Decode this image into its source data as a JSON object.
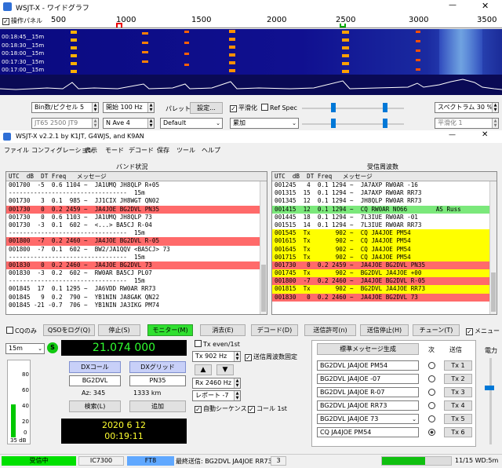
{
  "wide": {
    "title": "WSJT-X - ワイドグラフ",
    "controls_label": "操作パネル",
    "scale": [
      "500",
      "1000",
      "1500",
      "2000",
      "2500",
      "3000",
      "3500"
    ],
    "timestamps": [
      "00:18:45__15m",
      "00:18:30__15m",
      "00:18:00__15m",
      "00:17:30__15m",
      "00:17:00__15m"
    ],
    "bins_label": "Bin数/ピクセル 5",
    "start_label": "開始 100 Hz",
    "palette_label": "パレット",
    "settings_btn": "設定...",
    "smooth_label": "平滑化",
    "refspec_label": "Ref Spec",
    "spectrum_label": "スペクトラム 30 %",
    "jt65_label": "JT65 2500 JT9",
    "navg_label": "N Ave 4",
    "default_label": "Default",
    "cumul_label": "累加",
    "smooth_val": "平滑化 1"
  },
  "main": {
    "title": "WSJT-X  v2.2.1  by K1JT, G4WJS, and K9AN",
    "menu": [
      "ファイル",
      "コンフィグレーション",
      "表示",
      "モード",
      "デコード",
      "保存",
      "ツール",
      "ヘルプ"
    ],
    "band_title": "バンド状況",
    "rx_title": "受信周波数",
    "hdr_left": "UTC  dB  DT Freq   メッセージ",
    "hdr_right": "UTC  dB  DT Freq   メッセージ",
    "left_rows": [
      {
        "t": "001700  -5  0.6 1104 ~  JA1UMQ JH8QLP R+05",
        "c": ""
      },
      {
        "t": "---------------------------------  15m",
        "c": ""
      },
      {
        "t": "001730   3  0.1  985 ~  JJ1CIX JH8WGT QN02",
        "c": ""
      },
      {
        "t": "001730   0  0.2 2459 ~  JA4JOE BG2DVL PN35",
        "c": "red"
      },
      {
        "t": "001730   0  0.6 1103 ~  JA1UMQ JH8QLP 73",
        "c": ""
      },
      {
        "t": "001730  -3  0.1  602 ~  <...> BA5CJ R-04",
        "c": ""
      },
      {
        "t": "---------------------------------  15m",
        "c": ""
      },
      {
        "t": "001800  -7  0.2 2460 ~  JA4JOE BG2DVL R-05",
        "c": "red"
      },
      {
        "t": "001800  -7  0.1  602 ~  BW2/JA1QQV <BA5CJ> 73",
        "c": ""
      },
      {
        "t": "---------------------------------  15m",
        "c": ""
      },
      {
        "t": "001830   0  0.2 2460 ~  JA4JOE BG2DVL 73",
        "c": "red"
      },
      {
        "t": "001830  -3  0.2  602 ~  RW0AR BA5CJ PL07",
        "c": ""
      },
      {
        "t": "---------------------------------  15m",
        "c": ""
      },
      {
        "t": "001845  17  0.1 1295 ~  JA6VDD RW0AR RR73",
        "c": ""
      },
      {
        "t": "001845   9  0.2  790 ~  YB1NIN JA8GAK QN22",
        "c": ""
      },
      {
        "t": "001845 -21 -0.7  706 ~  YB1NIN JA3IKG PM74",
        "c": ""
      }
    ],
    "right_rows": [
      {
        "t": "001245   4  0.1 1294 ~  JA7AXP RW0AR -16",
        "c": ""
      },
      {
        "t": "001315  15  0.1 1294 ~  JA7AXP RW0AR RR73",
        "c": ""
      },
      {
        "t": "001345  12  0.1 1294 ~  JH8QLP RW0AR RR73",
        "c": ""
      },
      {
        "t": "001415  12  0.1 1294 ~  CQ RW0AR NO66        AS Russ",
        "c": "grn"
      },
      {
        "t": "001445  18  0.1 1294 ~  7L3IUE RW0AR -01",
        "c": ""
      },
      {
        "t": "001515  14  0.1 1294 ~  7L3IUE RW0AR RR73",
        "c": ""
      },
      {
        "t": "001545  Tx       902 ~  CQ JA4JOE PM54",
        "c": "yel"
      },
      {
        "t": "001615  Tx       902 ~  CQ JA4JOE PM54",
        "c": "yel"
      },
      {
        "t": "001645  Tx       902 ~  CQ JA4JOE PM54",
        "c": "yel"
      },
      {
        "t": "001715  Tx       902 ~  CQ JA4JOE PM54",
        "c": "yel"
      },
      {
        "t": "001730   0  0.2 2459 ~  JA4JOE BG2DVL PN35",
        "c": "red"
      },
      {
        "t": "001745  Tx       902 ~  BG2DVL JA4JOE +00",
        "c": "yel"
      },
      {
        "t": "001800  -7  0.2 2460 ~  JA4JOE BG2DVL R-05",
        "c": "red"
      },
      {
        "t": "001815  Tx       902 ~  BG2DVL JA4JOE RR73",
        "c": "yel"
      },
      {
        "t": "001830   0  0.2 2460 ~  JA4JOE BG2DVL 73",
        "c": "red"
      }
    ],
    "cq_only": "CQのみ",
    "buttons": [
      "QSOをログ(Q)",
      "停止(S)",
      "モニター(M)",
      "消去(E)",
      "デコード(D)",
      "送信許可(n)",
      "送信停止(H)",
      "チューン(T)"
    ],
    "menu_cb": "メニュー",
    "band": "15m",
    "freq": "21.074 000",
    "dxcall_btn": "DXコール",
    "dxgrid_btn": "DXグリッド",
    "dxcall": "BG2DVL",
    "dxgrid": "PN35",
    "az": "Az: 345",
    "dist": "1333 km",
    "lookup_btn": "検索(L)",
    "add_btn": "追加",
    "date": "2020 6 12",
    "time": "00:19:11",
    "db_label": "35 dB",
    "meter_ticks": [
      "80",
      "60",
      "40",
      "20",
      "0"
    ],
    "tx_even": "Tx even/1st",
    "tx_hz": "Tx  902  Hz",
    "hold_tx": "送信周波数固定",
    "rx_hz": "Rx  2460  Hz",
    "report": "レポート -7",
    "auto_seq": "自動シーケンス",
    "call_1st": "コール 1st",
    "gen_btn": "標準メッセージ生成",
    "next_label": "次",
    "send_label": "送信",
    "msgs": [
      "BG2DVL JA4JOE PM54",
      "BG2DVL JA4JOE -07",
      "BG2DVL JA4JOE R-07",
      "BG2DVL JA4JOE RR73",
      "BG2DVL JA4JOE 73",
      "CQ JA4JOE PM54"
    ],
    "tx_btns": [
      "Tx 1",
      "Tx 2",
      "Tx 3",
      "Tx 4",
      "Tx 5",
      "Tx 6"
    ],
    "power": "電力",
    "status_rx": "受信中",
    "status_rig": "IC7300",
    "status_mode": "FT8",
    "status_last": "最終送信: BG2DVL JA4JOE RR73",
    "status_num": "3",
    "status_right": "11/15  WD:5m"
  }
}
